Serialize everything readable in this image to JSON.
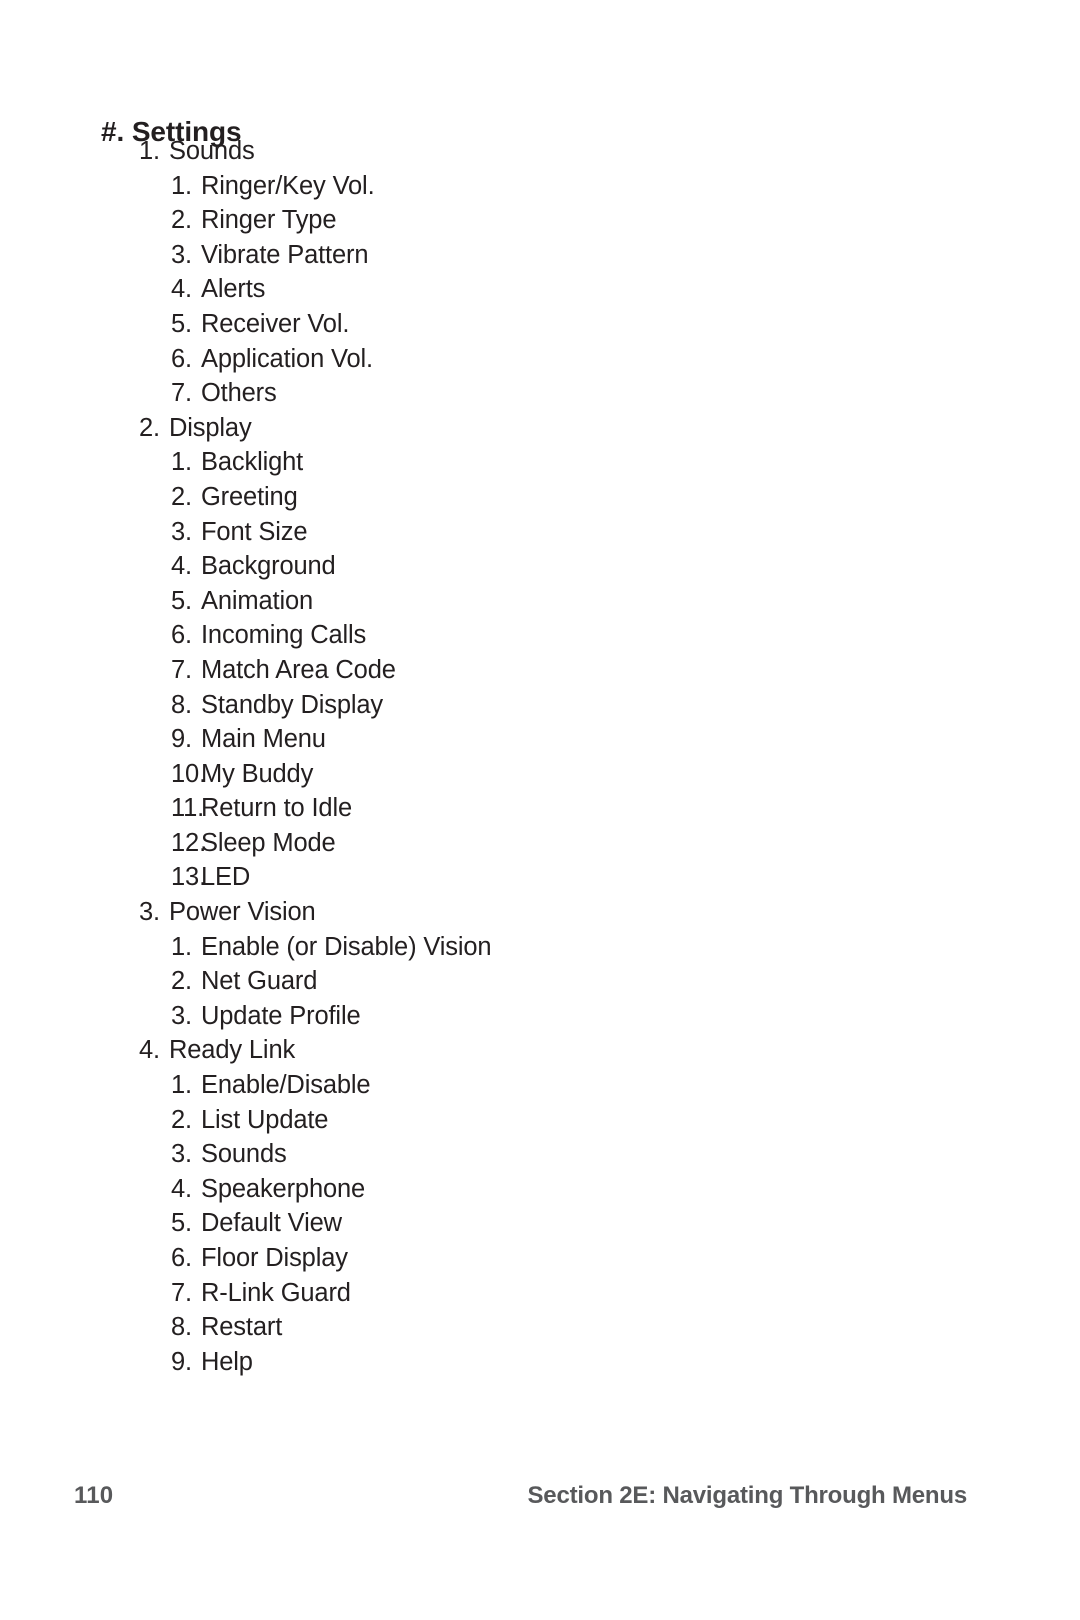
{
  "document": {
    "heading": "#. Settings",
    "text_color": "#231f20",
    "footer_color": "#58595b",
    "background_color": "#ffffff"
  },
  "outline": [
    {
      "level": 1,
      "marker": "1.",
      "label": "Sounds"
    },
    {
      "level": 2,
      "marker": "1.",
      "label": "Ringer/Key Vol."
    },
    {
      "level": 2,
      "marker": "2.",
      "label": "Ringer Type"
    },
    {
      "level": 2,
      "marker": "3.",
      "label": "Vibrate Pattern"
    },
    {
      "level": 2,
      "marker": "4.",
      "label": "Alerts"
    },
    {
      "level": 2,
      "marker": "5.",
      "label": "Receiver Vol."
    },
    {
      "level": 2,
      "marker": "6.",
      "label": "Application Vol."
    },
    {
      "level": 2,
      "marker": "7.",
      "label": "Others"
    },
    {
      "level": 1,
      "marker": "2.",
      "label": "Display"
    },
    {
      "level": 2,
      "marker": "1.",
      "label": "Backlight"
    },
    {
      "level": 2,
      "marker": "2.",
      "label": "Greeting"
    },
    {
      "level": 2,
      "marker": "3.",
      "label": "Font Size"
    },
    {
      "level": 2,
      "marker": "4.",
      "label": "Background"
    },
    {
      "level": 2,
      "marker": "5.",
      "label": "Animation"
    },
    {
      "level": 2,
      "marker": "6.",
      "label": "Incoming Calls"
    },
    {
      "level": 2,
      "marker": "7.",
      "label": "Match Area Code"
    },
    {
      "level": 2,
      "marker": "8.",
      "label": "Standby Display"
    },
    {
      "level": 2,
      "marker": "9.",
      "label": "Main Menu"
    },
    {
      "level": 2,
      "marker": "10.",
      "label": "My Buddy"
    },
    {
      "level": 2,
      "marker": "11.",
      "label": "Return to Idle"
    },
    {
      "level": 2,
      "marker": "12.",
      "label": "Sleep Mode"
    },
    {
      "level": 2,
      "marker": "13.",
      "label": "LED"
    },
    {
      "level": 1,
      "marker": "3.",
      "label": "Power Vision"
    },
    {
      "level": 2,
      "marker": "1.",
      "label": "Enable (or Disable) Vision"
    },
    {
      "level": 2,
      "marker": "2.",
      "label": "Net Guard"
    },
    {
      "level": 2,
      "marker": "3.",
      "label": "Update Profile"
    },
    {
      "level": 1,
      "marker": "4.",
      "label": "Ready Link"
    },
    {
      "level": 2,
      "marker": "1.",
      "label": "Enable/Disable"
    },
    {
      "level": 2,
      "marker": "2.",
      "label": "List Update"
    },
    {
      "level": 2,
      "marker": "3.",
      "label": "Sounds"
    },
    {
      "level": 2,
      "marker": "4.",
      "label": "Speakerphone"
    },
    {
      "level": 2,
      "marker": "5.",
      "label": "Default View"
    },
    {
      "level": 2,
      "marker": "6.",
      "label": "Floor Display"
    },
    {
      "level": 2,
      "marker": "7.",
      "label": "R-Link Guard"
    },
    {
      "level": 2,
      "marker": "8.",
      "label": "Restart"
    },
    {
      "level": 2,
      "marker": "9.",
      "label": "Help"
    }
  ],
  "footer": {
    "page_number": "110",
    "running_head": "Section 2E: Navigating Through Menus"
  }
}
